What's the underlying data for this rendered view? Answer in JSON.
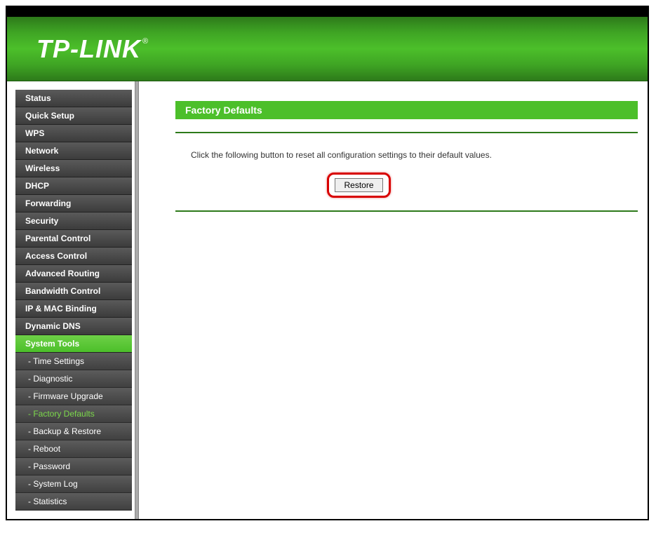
{
  "brand": "TP-LINK",
  "trademark": "®",
  "sidebar": {
    "items": [
      {
        "label": "Status"
      },
      {
        "label": "Quick Setup"
      },
      {
        "label": "WPS"
      },
      {
        "label": "Network"
      },
      {
        "label": "Wireless"
      },
      {
        "label": "DHCP"
      },
      {
        "label": "Forwarding"
      },
      {
        "label": "Security"
      },
      {
        "label": "Parental Control"
      },
      {
        "label": "Access Control"
      },
      {
        "label": "Advanced Routing"
      },
      {
        "label": "Bandwidth Control"
      },
      {
        "label": "IP & MAC Binding"
      },
      {
        "label": "Dynamic DNS"
      },
      {
        "label": "System Tools"
      }
    ],
    "subitems": [
      {
        "label": "- Time Settings"
      },
      {
        "label": "- Diagnostic"
      },
      {
        "label": "- Firmware Upgrade"
      },
      {
        "label": "- Factory Defaults"
      },
      {
        "label": "- Backup & Restore"
      },
      {
        "label": "- Reboot"
      },
      {
        "label": "- Password"
      },
      {
        "label": "- System Log"
      },
      {
        "label": "- Statistics"
      }
    ]
  },
  "main": {
    "title": "Factory Defaults",
    "instruction": "Click the following button to reset all configuration settings to their default values.",
    "restore_label": "Restore"
  }
}
